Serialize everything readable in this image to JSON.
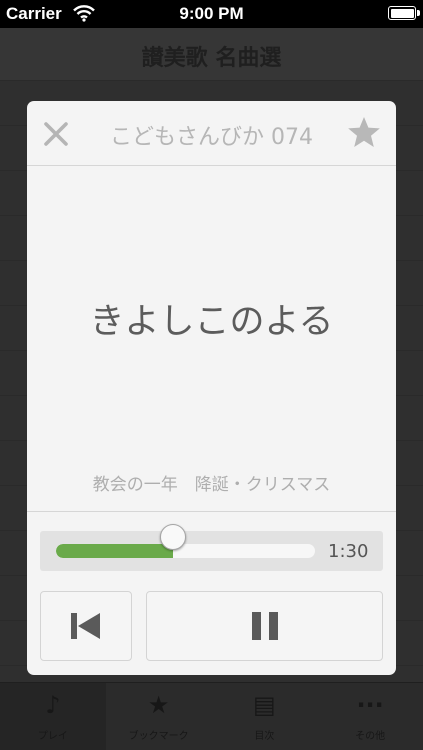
{
  "status_bar": {
    "carrier": "Carrier",
    "time": "9:00 PM",
    "wifi_icon": "wifi-icon",
    "battery_icon": "battery-icon"
  },
  "background_app": {
    "title": "讃美歌 名曲選",
    "tabs": [
      {
        "label": "プレイ",
        "icon": "music-note-icon",
        "selected": true
      },
      {
        "label": "ブックマーク",
        "icon": "star-icon"
      },
      {
        "label": "目次",
        "icon": "book-icon"
      },
      {
        "label": "その他",
        "icon": "more-icon"
      }
    ]
  },
  "player": {
    "title": "こどもさんびか 074",
    "song_title": "きよしこのよる",
    "category": "教会の一年　降誕・クリスマス",
    "time_remaining": "1:30",
    "progress_fraction": 0.45,
    "close_icon": "close-icon",
    "favorite_icon": "star-icon",
    "previous_icon": "skip-previous-icon",
    "pause_icon": "pause-icon"
  },
  "colors": {
    "progress_fill": "#6aaa4a",
    "modal_background": "#f4f4f4",
    "title_gray": "#b6b6b6",
    "song_title_gray": "#5c5c5c"
  }
}
